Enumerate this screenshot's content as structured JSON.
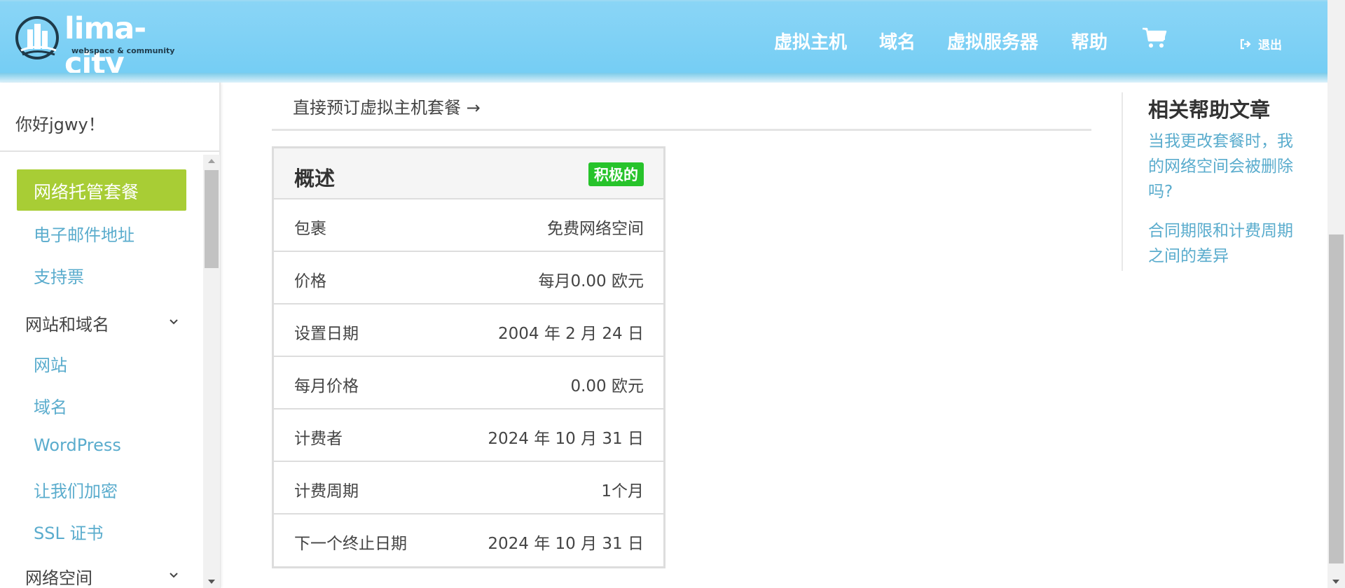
{
  "header": {
    "logo_text": "lima-city",
    "logo_subtext": "webspace & community",
    "nav": [
      "虚拟主机",
      "域名",
      "虚拟服务器",
      "帮助"
    ],
    "cart_icon": "shopping-cart-icon",
    "logout_icon": "sign-out-icon",
    "logout_label": "退出"
  },
  "sidebar": {
    "greeting": "你好jgwy！",
    "active_item": "网络托管套餐",
    "links_top": [
      "电子邮件地址",
      "支持票"
    ],
    "group1": {
      "label": "网站和域名",
      "icon": "chevron-down-icon"
    },
    "group1_items": [
      "网站",
      "域名",
      "WordPress",
      "让我们加密",
      "SSL 证书"
    ],
    "group2": {
      "label": "网络空间",
      "icon": "chevron-down-icon"
    }
  },
  "main": {
    "book_link": "直接预订虚拟主机套餐 →",
    "panel": {
      "title": "概述",
      "status": "积极的",
      "rows": [
        {
          "label": "包裹",
          "value": "免费网络空间"
        },
        {
          "label": "价格",
          "value": "每月0.00 欧元"
        },
        {
          "label": "设置日期",
          "value": "2004 年 2 月 24 日"
        },
        {
          "label": "每月价格",
          "value": "0.00 欧元"
        },
        {
          "label": "计费者",
          "value": "2024 年 10 月 31 日"
        },
        {
          "label": "计费周期",
          "value": "1个月"
        },
        {
          "label": "下一个终止日期",
          "value": "2024 年 10 月 31 日"
        }
      ]
    }
  },
  "help": {
    "title": "相关帮助文章",
    "links": [
      "当我更改套餐时，我的网络空间会被删除吗?",
      "合同期限和计费周期之间的差异"
    ]
  },
  "colors": {
    "header": "#7fd1f5",
    "accent_green": "#a8cd35",
    "badge_green": "#27c32b",
    "link_blue": "#5aaccd"
  }
}
